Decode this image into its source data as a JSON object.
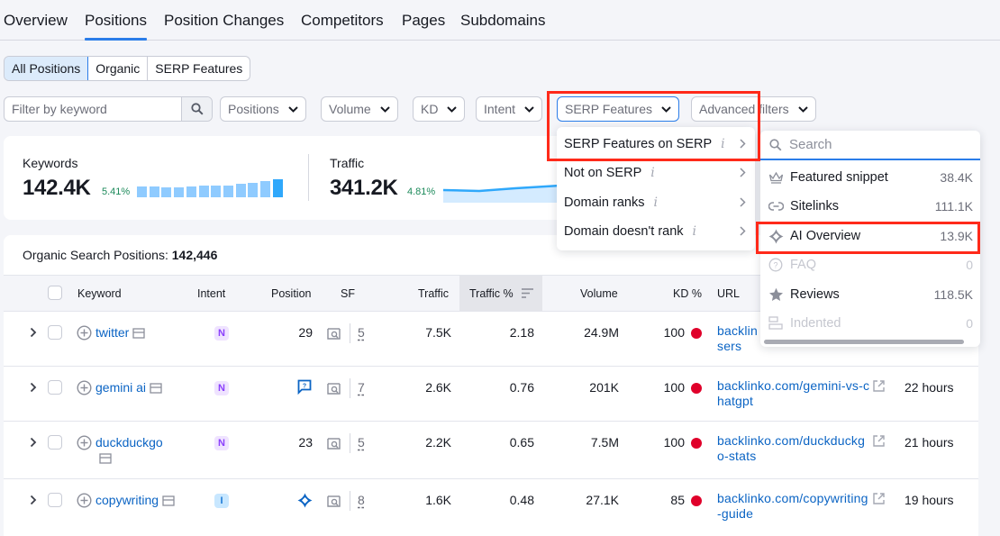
{
  "tabs": [
    {
      "label": "Overview",
      "active": false
    },
    {
      "label": "Positions",
      "active": true
    },
    {
      "label": "Position Changes",
      "active": false
    },
    {
      "label": "Competitors",
      "active": false
    },
    {
      "label": "Pages",
      "active": false
    },
    {
      "label": "Subdomains",
      "active": false
    }
  ],
  "segments": [
    {
      "label": "All Positions",
      "active": true
    },
    {
      "label": "Organic",
      "active": false
    },
    {
      "label": "SERP Features",
      "active": false
    }
  ],
  "filters": {
    "keyword_placeholder": "Filter by keyword",
    "keyword_value": "",
    "dropdowns": [
      "Positions",
      "Volume",
      "KD",
      "Intent",
      "SERP Features",
      "Advanced filters"
    ]
  },
  "summary": {
    "keywords": {
      "label": "Keywords",
      "value": "142.4K",
      "delta": "5.41%",
      "trend": [
        0.6,
        0.58,
        0.55,
        0.54,
        0.6,
        0.65,
        0.63,
        0.65,
        0.73,
        0.8,
        0.92,
        1.0
      ]
    },
    "traffic": {
      "label": "Traffic",
      "value": "341.2K",
      "delta": "4.81%"
    }
  },
  "table": {
    "title": "Organic Search Positions:",
    "total": "142,446",
    "headers": {
      "keyword": "Keyword",
      "intent": "Intent",
      "position": "Position",
      "sf": "SF",
      "traffic": "Traffic",
      "traffic_pct": "Traffic %",
      "volume": "Volume",
      "kd": "KD %",
      "url": "URL"
    },
    "rows": [
      {
        "keyword": "twitter",
        "intent": "N",
        "position": "29",
        "serp_icon": "",
        "sf": "5",
        "traffic": "7.5K",
        "traffic_pct": "2.18",
        "volume": "24.9M",
        "kd": "100",
        "url": "backlinko.com/twitter-users",
        "url_visible": "backlin\nsers",
        "updated": ""
      },
      {
        "keyword": "gemini ai",
        "intent": "N",
        "position": "",
        "serp_icon": "faq",
        "sf": "7",
        "traffic": "2.6K",
        "traffic_pct": "0.76",
        "volume": "201K",
        "kd": "100",
        "url": "backlinko.com/gemini-vs-chatgpt",
        "updated": "22 hours"
      },
      {
        "keyword": "duckduckgo",
        "intent": "N",
        "position": "23",
        "serp_icon": "",
        "sf": "5",
        "traffic": "2.2K",
        "traffic_pct": "0.65",
        "volume": "7.5M",
        "kd": "100",
        "url": "backlinko.com/duckduckgo-stats",
        "updated": "21 hours"
      },
      {
        "keyword": "copywriting",
        "intent": "I",
        "position": "",
        "serp_icon": "ai-overview",
        "sf": "8",
        "traffic": "1.6K",
        "traffic_pct": "0.48",
        "volume": "27.1K",
        "kd": "85",
        "url": "backlinko.com/copywriting-guide",
        "updated": "19 hours"
      }
    ]
  },
  "serp_menu": {
    "items": [
      {
        "label": "SERP Features on SERP",
        "highlighted": true
      },
      {
        "label": "Not on SERP",
        "highlighted": false
      },
      {
        "label": "Domain ranks",
        "highlighted": false
      },
      {
        "label": "Domain doesn't rank",
        "highlighted": false
      }
    ]
  },
  "serp_submenu": {
    "search_placeholder": "Search",
    "items": [
      {
        "label": "Featured snippet",
        "count": "38.4K",
        "icon": "crown-icon",
        "disabled": false
      },
      {
        "label": "Sitelinks",
        "count": "111.1K",
        "icon": "link-icon",
        "disabled": false
      },
      {
        "label": "AI Overview",
        "count": "13.9K",
        "icon": "ai-overview-icon",
        "disabled": false,
        "highlighted": true
      },
      {
        "label": "FAQ",
        "count": "0",
        "icon": "question-icon",
        "disabled": true
      },
      {
        "label": "Reviews",
        "count": "118.5K",
        "icon": "star-icon",
        "disabled": false
      },
      {
        "label": "Indented",
        "count": "0",
        "icon": "indented-icon",
        "disabled": true
      }
    ]
  },
  "colors": {
    "accent": "#2b7de9",
    "link": "#0b64c4",
    "positive": "#1d8a5b",
    "kd_hard": "#e0002a",
    "highlight_box": "#ff2a1a"
  }
}
